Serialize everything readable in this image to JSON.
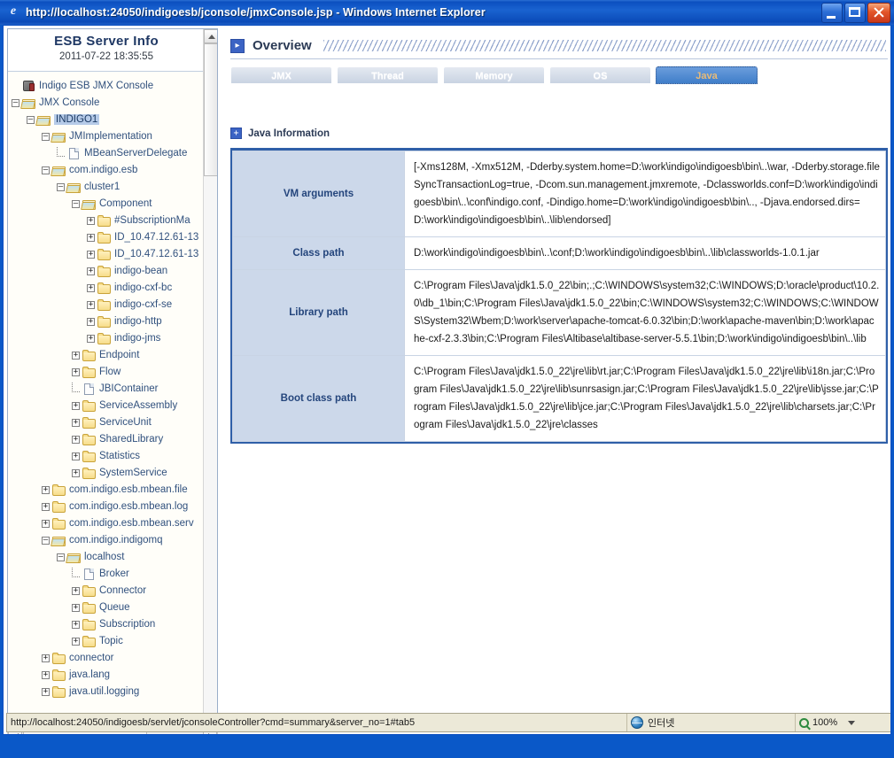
{
  "window": {
    "title": "http://localhost:24050/indigoesb/jconsole/jmxConsole.jsp - Windows Internet Explorer",
    "icon": "ie-icon",
    "buttons": {
      "minimize": "minimize-button",
      "maximize": "maximize-button",
      "close": "close-button"
    }
  },
  "sidebar": {
    "title": "ESB Server Info",
    "timestamp": "2011-07-22 18:35:55",
    "tree": [
      {
        "label": "Indigo ESB JMX Console",
        "indent": 0,
        "toggle": "none",
        "icon": "console-icon",
        "selected": false
      },
      {
        "label": "JMX Console",
        "indent": 0,
        "toggle": "minus",
        "icon": "folder-open-icon",
        "selected": false
      },
      {
        "label": "INDIGO1",
        "indent": 1,
        "toggle": "minus",
        "icon": "folder-open-icon",
        "selected": true
      },
      {
        "label": "JMImplementation",
        "indent": 2,
        "toggle": "minus",
        "icon": "folder-open-icon",
        "selected": false
      },
      {
        "label": "MBeanServerDelegate",
        "indent": 3,
        "toggle": "leaf",
        "icon": "document-icon",
        "selected": false
      },
      {
        "label": "com.indigo.esb",
        "indent": 2,
        "toggle": "minus",
        "icon": "folder-open-icon",
        "selected": false
      },
      {
        "label": "cluster1",
        "indent": 3,
        "toggle": "minus",
        "icon": "folder-open-icon",
        "selected": false
      },
      {
        "label": "Component",
        "indent": 4,
        "toggle": "minus",
        "icon": "folder-open-icon",
        "selected": false
      },
      {
        "label": "#SubscriptionMa",
        "indent": 5,
        "toggle": "plus",
        "icon": "folder-icon",
        "selected": false
      },
      {
        "label": "ID_10.47.12.61-13",
        "indent": 5,
        "toggle": "plus",
        "icon": "folder-icon",
        "selected": false
      },
      {
        "label": "ID_10.47.12.61-13",
        "indent": 5,
        "toggle": "plus",
        "icon": "folder-icon",
        "selected": false
      },
      {
        "label": "indigo-bean",
        "indent": 5,
        "toggle": "plus",
        "icon": "folder-icon",
        "selected": false
      },
      {
        "label": "indigo-cxf-bc",
        "indent": 5,
        "toggle": "plus",
        "icon": "folder-icon",
        "selected": false
      },
      {
        "label": "indigo-cxf-se",
        "indent": 5,
        "toggle": "plus",
        "icon": "folder-icon",
        "selected": false
      },
      {
        "label": "indigo-http",
        "indent": 5,
        "toggle": "plus",
        "icon": "folder-icon",
        "selected": false
      },
      {
        "label": "indigo-jms",
        "indent": 5,
        "toggle": "plus",
        "icon": "folder-icon",
        "selected": false
      },
      {
        "label": "Endpoint",
        "indent": 4,
        "toggle": "plus",
        "icon": "folder-icon",
        "selected": false
      },
      {
        "label": "Flow",
        "indent": 4,
        "toggle": "plus",
        "icon": "folder-icon",
        "selected": false
      },
      {
        "label": "JBIContainer",
        "indent": 4,
        "toggle": "leaf",
        "icon": "document-icon",
        "selected": false
      },
      {
        "label": "ServiceAssembly",
        "indent": 4,
        "toggle": "plus",
        "icon": "folder-icon",
        "selected": false
      },
      {
        "label": "ServiceUnit",
        "indent": 4,
        "toggle": "plus",
        "icon": "folder-icon",
        "selected": false
      },
      {
        "label": "SharedLibrary",
        "indent": 4,
        "toggle": "plus",
        "icon": "folder-icon",
        "selected": false
      },
      {
        "label": "Statistics",
        "indent": 4,
        "toggle": "plus",
        "icon": "folder-icon",
        "selected": false
      },
      {
        "label": "SystemService",
        "indent": 4,
        "toggle": "plus",
        "icon": "folder-icon",
        "selected": false
      },
      {
        "label": "com.indigo.esb.mbean.file",
        "indent": 2,
        "toggle": "plus",
        "icon": "folder-icon",
        "selected": false
      },
      {
        "label": "com.indigo.esb.mbean.log",
        "indent": 2,
        "toggle": "plus",
        "icon": "folder-icon",
        "selected": false
      },
      {
        "label": "com.indigo.esb.mbean.serv",
        "indent": 2,
        "toggle": "plus",
        "icon": "folder-icon",
        "selected": false
      },
      {
        "label": "com.indigo.indigomq",
        "indent": 2,
        "toggle": "minus",
        "icon": "folder-open-icon",
        "selected": false
      },
      {
        "label": "localhost",
        "indent": 3,
        "toggle": "minus",
        "icon": "folder-open-icon",
        "selected": false
      },
      {
        "label": "Broker",
        "indent": 4,
        "toggle": "leaf",
        "icon": "document-icon",
        "selected": false
      },
      {
        "label": "Connector",
        "indent": 4,
        "toggle": "plus",
        "icon": "folder-icon",
        "selected": false
      },
      {
        "label": "Queue",
        "indent": 4,
        "toggle": "plus",
        "icon": "folder-icon",
        "selected": false
      },
      {
        "label": "Subscription",
        "indent": 4,
        "toggle": "plus",
        "icon": "folder-icon",
        "selected": false
      },
      {
        "label": "Topic",
        "indent": 4,
        "toggle": "plus",
        "icon": "folder-icon",
        "selected": false
      },
      {
        "label": "connector",
        "indent": 2,
        "toggle": "plus",
        "icon": "folder-icon",
        "selected": false
      },
      {
        "label": "java.lang",
        "indent": 2,
        "toggle": "plus",
        "icon": "folder-icon",
        "selected": false
      },
      {
        "label": "java.util.logging",
        "indent": 2,
        "toggle": "plus",
        "icon": "folder-icon",
        "selected": false
      }
    ]
  },
  "main": {
    "header": {
      "title": "Overview",
      "icon": "chevron-right-icon"
    },
    "tabs": [
      {
        "label": "JMX",
        "active": false
      },
      {
        "label": "Thread",
        "active": false
      },
      {
        "label": "Memory",
        "active": false
      },
      {
        "label": "OS",
        "active": false
      },
      {
        "label": "Java",
        "active": true
      }
    ],
    "section": {
      "title": "Java Information",
      "icon": "plus-box-icon"
    },
    "rows": [
      {
        "key": "VM arguments",
        "value": "[-Xms128M, -Xmx512M, -Dderby.system.home=D:\\work\\indigo\\indigoesb\\bin\\..\\war, -Dderby.storage.fileSyncTransactionLog=true, -Dcom.sun.management.jmxremote, -Dclassworlds.conf=D:\\work\\indigo\\indigoesb\\bin\\..\\conf\\indigo.conf, -Dindigo.home=D:\\work\\indigo\\indigoesb\\bin\\.., -Djava.endorsed.dirs=D:\\work\\indigo\\indigoesb\\bin\\..\\lib\\endorsed]"
      },
      {
        "key": "Class path",
        "value": "D:\\work\\indigo\\indigoesb\\bin\\..\\conf;D:\\work\\indigo\\indigoesb\\bin\\..\\lib\\classworlds-1.0.1.jar"
      },
      {
        "key": "Library path",
        "value": "C:\\Program Files\\Java\\jdk1.5.0_22\\bin;.;C:\\WINDOWS\\system32;C:\\WINDOWS;D:\\oracle\\product\\10.2.0\\db_1\\bin;C:\\Program Files\\Java\\jdk1.5.0_22\\bin;C:\\WINDOWS\\system32;C:\\WINDOWS;C:\\WINDOWS\\System32\\Wbem;D:\\work\\server\\apache-tomcat-6.0.32\\bin;D:\\work\\apache-maven\\bin;D:\\work\\apache-cxf-2.3.3\\bin;C:\\Program Files\\Altibase\\altibase-server-5.5.1\\bin;D:\\work\\indigo\\indigoesb\\bin\\..\\lib"
      },
      {
        "key": "Boot class path",
        "value": "C:\\Program Files\\Java\\jdk1.5.0_22\\jre\\lib\\rt.jar;C:\\Program Files\\Java\\jdk1.5.0_22\\jre\\lib\\i18n.jar;C:\\Program Files\\Java\\jdk1.5.0_22\\jre\\lib\\sunrsasign.jar;C:\\Program Files\\Java\\jdk1.5.0_22\\jre\\lib\\jsse.jar;C:\\Program Files\\Java\\jdk1.5.0_22\\jre\\lib\\jce.jar;C:\\Program Files\\Java\\jdk1.5.0_22\\jre\\lib\\charsets.jar;C:\\Program Files\\Java\\jdk1.5.0_22\\jre\\classes"
      }
    ]
  },
  "statusbar": {
    "url": "http://localhost:24050/indigoesb/servlet/jconsoleController?cmd=summary&server_no=1#tab5",
    "zone": "인터넷",
    "zone_icon": "globe-icon",
    "zoom": "100%",
    "zoom_icon": "magnifier-icon"
  },
  "colors": {
    "title_blue": "#0b4fc0",
    "accent": "#2f5fa8",
    "tab_active": "#3f7ec9",
    "key_cell": "#ccd8ea",
    "tree_text": "#30507d"
  }
}
